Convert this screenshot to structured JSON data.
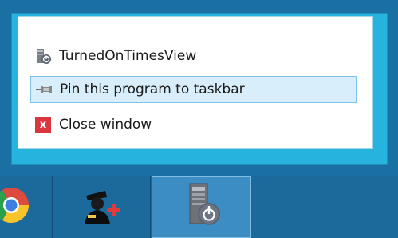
{
  "jumplist": {
    "items": [
      {
        "label": "TurnedOnTimesView",
        "icon": "turnedontimesview-app-icon"
      },
      {
        "label": "Pin this program to taskbar",
        "icon": "pin-icon",
        "highlighted": true
      },
      {
        "label": "Close window",
        "icon": "close-icon",
        "glyph": "x"
      }
    ]
  },
  "taskbar": {
    "buttons": [
      {
        "name": "chrome",
        "icon": "chrome-icon"
      },
      {
        "name": "user-admin",
        "icon": "user-add-icon"
      },
      {
        "name": "turnedontimesview",
        "icon": "turnedontimesview-app-icon",
        "active": true
      }
    ]
  },
  "colors": {
    "frame": "#1a6fa3",
    "accent": "#26b4df",
    "highlight": "#d8eefa",
    "close_red": "#d9363e",
    "taskbar": "#1c6a9c"
  }
}
